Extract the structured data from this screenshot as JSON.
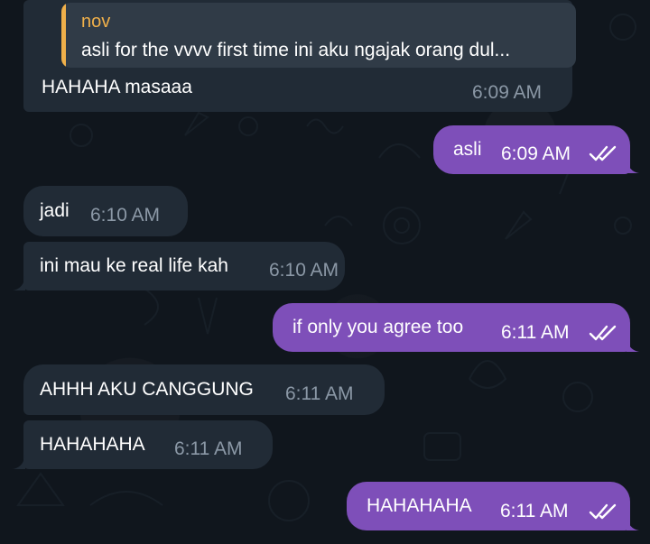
{
  "chat": {
    "messages": [
      {
        "direction": "in",
        "reply": {
          "name": "nov",
          "text": "asli for the vvvv first time ini aku ngajak orang dul..."
        },
        "text": "HAHAHA masaaa",
        "time": "6:09 AM"
      },
      {
        "direction": "out",
        "text": "asli",
        "time": "6:09 AM",
        "status": "read"
      },
      {
        "direction": "in",
        "text": "jadi",
        "time": "6:10 AM"
      },
      {
        "direction": "in",
        "text": "ini mau ke real life kah",
        "time": "6:10 AM"
      },
      {
        "direction": "out",
        "text": "if only you agree too",
        "time": "6:11 AM",
        "status": "read"
      },
      {
        "direction": "in",
        "text": "AHHH AKU CANGGUNG",
        "time": "6:11 AM"
      },
      {
        "direction": "in",
        "text": "HAHAHAHA",
        "time": "6:11 AM"
      },
      {
        "direction": "out",
        "text": "HAHAHAHA",
        "time": "6:11 AM",
        "status": "read"
      }
    ]
  },
  "theme": {
    "background": "#10161d",
    "incoming_bubble": "#212b36",
    "outgoing_bubble": "#7e4fb9",
    "reply_accent": "#f0b04a"
  },
  "icons": {
    "read_receipt": "double-check-icon"
  }
}
